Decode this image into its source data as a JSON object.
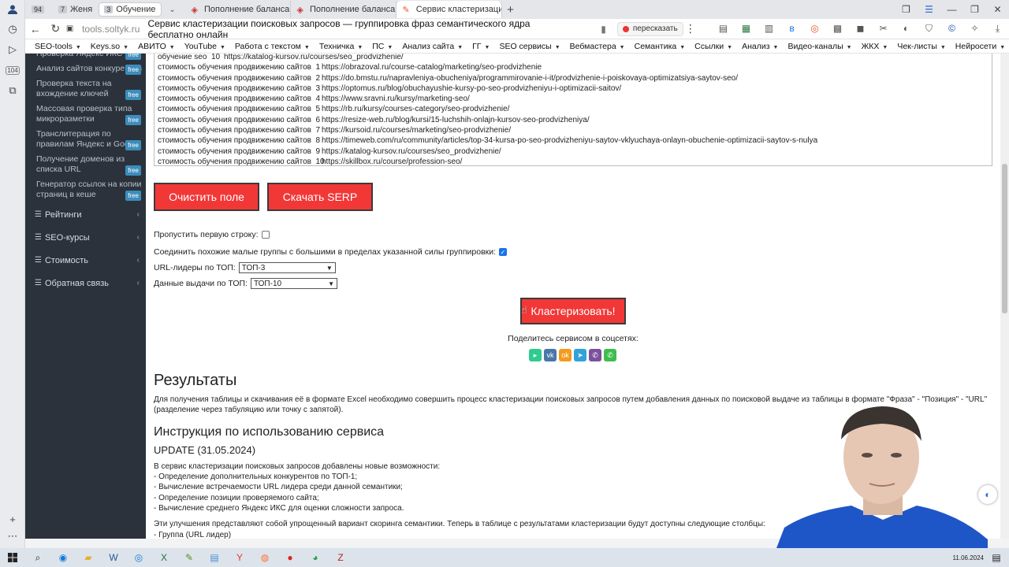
{
  "browser_sidebar": {
    "badge": "104"
  },
  "tabs": {
    "group1": {
      "num": "94",
      "label": ""
    },
    "group2": {
      "num": "7",
      "label": "Женя"
    },
    "group3": {
      "num": "3",
      "label": "Обучение"
    },
    "items": [
      {
        "label": "Пополнение баланса",
        "active": false
      },
      {
        "label": "Пополнение баланса",
        "active": false
      },
      {
        "label": "Сервис кластеризаци",
        "active": true
      }
    ]
  },
  "address": {
    "host": "tools.soltyk.ru",
    "title": "Сервис кластеризации поисковых запросов — группировка фраз семантического ядра бесплатно онлайн",
    "retell_label": "пересказать"
  },
  "bookmarks": [
    {
      "label": "SEO-tools",
      "dropdown": true
    },
    {
      "label": "Keys.so",
      "dropdown": true
    },
    {
      "label": "АВИТО",
      "dropdown": true
    },
    {
      "label": "YouTube",
      "dropdown": true
    },
    {
      "label": "Работа с текстом",
      "dropdown": true
    },
    {
      "label": "Техничка",
      "dropdown": true
    },
    {
      "label": "ПС",
      "dropdown": true
    },
    {
      "label": "Анализ сайта",
      "dropdown": true
    },
    {
      "label": "ГГ",
      "dropdown": true
    },
    {
      "label": "SEO сервисы",
      "dropdown": true
    },
    {
      "label": "Вебмастера",
      "dropdown": true
    },
    {
      "label": "Семантика",
      "dropdown": true
    },
    {
      "label": "Ссылки",
      "dropdown": true
    },
    {
      "label": "Анализ",
      "dropdown": true
    },
    {
      "label": "Видео-каналы",
      "dropdown": true
    },
    {
      "label": "ЖКХ",
      "dropdown": true
    },
    {
      "label": "Чек-листы",
      "dropdown": true
    },
    {
      "label": "Нейросети",
      "dropdown": true
    }
  ],
  "sitenav": {
    "sub_items": [
      {
        "label": "Проверка Яндекс ИКС",
        "free": true
      },
      {
        "label": "Анализ сайтов конкурентов",
        "free": true
      },
      {
        "label": "Проверка текста на вхождение ключей",
        "free": true
      },
      {
        "label": "Массовая проверка типа микроразметки",
        "free": true
      },
      {
        "label": "Транслитерация по правилам Яндекс и Google",
        "free": true
      },
      {
        "label": "Получение доменов из списка URL",
        "free": true
      },
      {
        "label": "Генератор ссылок на копии страниц в кеше",
        "free": true
      }
    ],
    "free_label": "free",
    "main_items": [
      {
        "label": "Рейтинги"
      },
      {
        "label": "SEO-курсы"
      },
      {
        "label": "Стоимость"
      },
      {
        "label": "Обратная связь"
      }
    ]
  },
  "serp": {
    "lines": [
      {
        "kw": "обучение seo  10",
        "url": "https://katalog-kursov.ru/courses/seo_prodvizhenie/",
        "compact": true
      },
      {
        "kw": "стоимость обучения продвижению сайтов  1",
        "url": "https://obrazoval.ru/course-catalog/marketing/seo-prodvizhenie"
      },
      {
        "kw": "стоимость обучения продвижению сайтов  2",
        "url": "https://do.bmstu.ru/napravleniya-obucheniya/programmirovanie-i-it/prodvizhenie-i-poiskovaya-optimizatsiya-saytov-seo/"
      },
      {
        "kw": "стоимость обучения продвижению сайтов  3",
        "url": "https://optomus.ru/blog/obuchayushie-kursy-po-seo-prodvizheniyu-i-optimizacii-saitov/"
      },
      {
        "kw": "стоимость обучения продвижению сайтов  4",
        "url": "https://www.sravni.ru/kursy/marketing-seo/"
      },
      {
        "kw": "стоимость обучения продвижению сайтов  5",
        "url": "https://rb.ru/kursy/courses-category/seo-prodvizhenie/"
      },
      {
        "kw": "стоимость обучения продвижению сайтов  6",
        "url": "https://resize-web.ru/blog/kursi/15-luchshih-onlajn-kursov-seo-prodvizheniya/"
      },
      {
        "kw": "стоимость обучения продвижению сайтов  7",
        "url": "https://kursoid.ru/courses/marketing/seo-prodvizhenie/"
      },
      {
        "kw": "стоимость обучения продвижению сайтов  8",
        "url": "https://timeweb.com/ru/community/articles/top-34-kursa-po-seo-prodvizheniyu-saytov-vklyuchaya-onlayn-obuchenie-optimizacii-saytov-s-nulya"
      },
      {
        "kw": "стоимость обучения продвижению сайтов  9",
        "url": "https://katalog-kursov.ru/courses/seo_prodvizhenie/"
      },
      {
        "kw": "стоимость обучения продвижению сайтов  10",
        "url": "https://skillbox.ru/course/profession-seo/"
      }
    ]
  },
  "buttons": {
    "clear": "Очистить поле",
    "download": "Скачать SERP",
    "cluster": "Кластеризовать!"
  },
  "options": {
    "skip_first_row": {
      "label": "Пропустить первую строку:",
      "checked": false
    },
    "merge_groups": {
      "label": "Соединить похожие малые группы с большими в пределах указанной силы группировки:",
      "checked": true
    },
    "url_leaders": {
      "label": "URL-лидеры по ТОП:",
      "value": "ТОП-3"
    },
    "serp_data": {
      "label": "Данные выдачи по ТОП:",
      "value": "ТОП-10"
    }
  },
  "share": {
    "label": "Поделитесь сервисом в соцсетях:",
    "icons": [
      {
        "name": "max",
        "color": "#2ecc8f"
      },
      {
        "name": "vk",
        "color": "#4a76a8"
      },
      {
        "name": "ok",
        "color": "#f59a1f"
      },
      {
        "name": "telegram",
        "color": "#30a3d8"
      },
      {
        "name": "viber",
        "color": "#7b519d"
      },
      {
        "name": "whatsapp",
        "color": "#3ebd4e"
      }
    ]
  },
  "results": {
    "title": "Результаты",
    "text": "Для получения таблицы и скачивания её в формате Excel необходимо совершить процесс кластеризации поисковых запросов путем добавления данных по поисковой выдаче из таблицы в формате \"Фраза\" - \"Позиция\" - \"URL\" (разделение через табуляцию или точку с запятой)."
  },
  "instructions": {
    "title": "Инструкция по использованию сервиса",
    "update": "UPDATE (31.05.2024)",
    "intro": "В сервис кластеризации поисковых запросов добавлены новые возможности:",
    "items": [
      "- Определение дополнительных конкурентов по ТОП-1;",
      "- Вычисление встречаемости URL лидера среди данной семантики;",
      "- Определение позиции проверяемого сайта;",
      "- Вычисление среднего Яндекс ИКС для оценки сложности запроса."
    ],
    "outro": "Эти улучшения представляют собой упрощенный вариант скоринга семантики. Теперь в таблице с результатами кластеризации будут доступны следующие столбцы:",
    "cut_line": "- Группа (URL лидер)"
  },
  "taskbar": {
    "date": "11.06.2024"
  },
  "colors": {
    "accent_red": "#f23737",
    "sidebar_bg": "#2b323b",
    "free_badge": "#3c8dbc"
  }
}
